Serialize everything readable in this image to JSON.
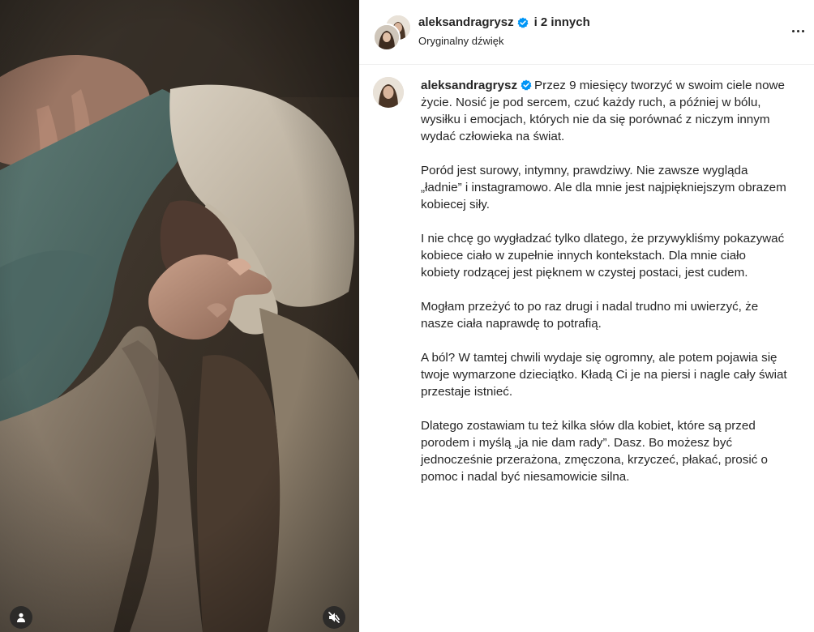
{
  "header": {
    "username": "aleksandragrysz",
    "others": "i 2 innych",
    "audio": "Oryginalny dźwięk"
  },
  "caption": {
    "username": "aleksandragrysz",
    "paragraphs": [
      "Przez 9 miesięcy tworzyć w swoim ciele nowe życie. Nosić je pod sercem, czuć każdy ruch, a później w bólu, wysiłku i emocjach, których nie da się porównać z niczym innym wydać człowieka na świat.",
      "Poród jest surowy, intymny, prawdziwy. Nie zawsze wygląda „ładnie” i instagramowo. Ale dla mnie jest najpiękniejszym obrazem kobiecej siły.",
      "I nie chcę go wygładzać tylko dlatego, że przywykliśmy pokazywać kobiece ciało w zupełnie innych kontekstach. Dla mnie ciało kobiety rodzącej jest pięknem w czystej postaci, jest cudem.",
      "Mogłam przeżyć to po raz drugi i nadal trudno mi uwierzyć, że nasze ciała naprawdę to potrafią.",
      "A ból? W tamtej chwili wydaje się ogromny, ale potem pojawia się twoje wymarzone dzieciątko. Kładą Ci je na piersi i nagle cały świat przestaje istnieć.",
      "Dlatego zostawiam tu też kilka słów dla kobiet, które są przed porodem i myślą „ja nie dam rady”. Dasz. Bo możesz być jednocześnie przerażona, zmęczona, krzyczeć, płakać, prosić o pomoc i nadal być niesamowicie silna."
    ]
  },
  "icons": {
    "verified": "verified-badge-icon",
    "more": "more-options-icon",
    "tag": "user-tag-icon",
    "mute": "speaker-muted-icon"
  },
  "colors": {
    "verified": "#0095f6",
    "text": "#262626",
    "border": "#efefef",
    "media_button_bg": "#262626"
  }
}
